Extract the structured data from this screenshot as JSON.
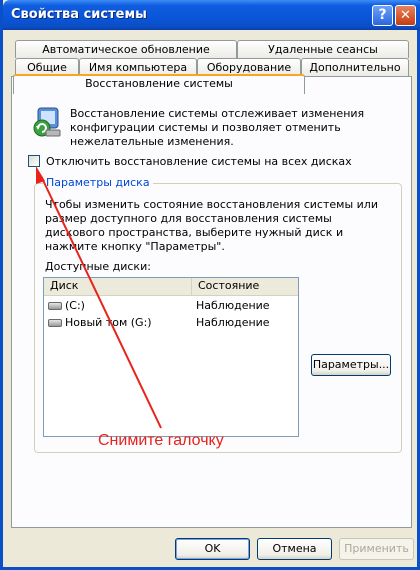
{
  "window": {
    "title": "Свойства системы",
    "help_glyph": "?",
    "close_glyph": "✕"
  },
  "tabs_row1": [
    {
      "label": "Автоматическое обновление"
    },
    {
      "label": "Удаленные сеансы"
    }
  ],
  "tabs_row2": [
    {
      "label": "Общие"
    },
    {
      "label": "Имя компьютера"
    },
    {
      "label": "Оборудование"
    },
    {
      "label": "Дополнительно"
    }
  ],
  "active_tab": {
    "label": "Восстановление системы"
  },
  "panel": {
    "description": "Восстановление системы отслеживает изменения конфигурации системы и позволяет отменить нежелательные изменения.",
    "checkbox_label": "Отключить восстановление системы на всех дисках",
    "checkbox_checked": false
  },
  "disk_group": {
    "legend": "Параметры диска",
    "description": "Чтобы изменить состояние восстановления системы или размер доступного для восстановления системы дискового пространства, выберите нужный диск и нажмите кнопку \"Параметры\".",
    "available_label": "Доступные диски:",
    "columns": [
      "Диск",
      "Состояние"
    ],
    "rows": [
      {
        "name": "(C:)",
        "status": "Наблюдение"
      },
      {
        "name": "Новый том (G:)",
        "status": "Наблюдение"
      }
    ],
    "settings_button": "Параметры..."
  },
  "footer": {
    "ok": "OK",
    "cancel": "Отмена",
    "apply": "Применить"
  },
  "annotation": {
    "text": "Снимите галочку",
    "color": "#e8231b"
  },
  "colors": {
    "title_bar": "#0a55d8",
    "active_tab_accent": "#f5a624",
    "group_legend": "#0046d5"
  }
}
